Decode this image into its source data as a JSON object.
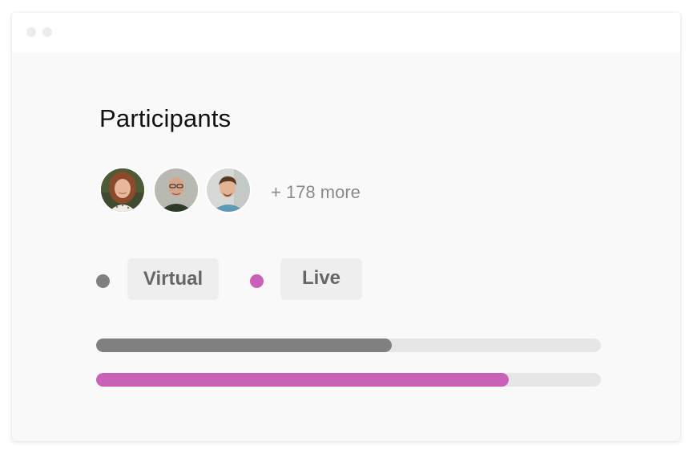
{
  "title": "Participants",
  "participants": {
    "more_label": "+ 178 more",
    "avatars": [
      {
        "icon": "avatar-woman-photo"
      },
      {
        "icon": "avatar-bald-man-glasses-photo"
      },
      {
        "icon": "avatar-young-man-photo"
      }
    ]
  },
  "legend": {
    "virtual": {
      "label": "Virtual",
      "color": "#808080"
    },
    "live": {
      "label": "Live",
      "color": "#c961b8"
    }
  },
  "progress": [
    {
      "series": "virtual",
      "fraction": 0.585,
      "color": "#808080",
      "track_color": "#e6e6e6"
    },
    {
      "series": "live",
      "fraction": 0.817,
      "color": "#c961b8",
      "track_color": "#e6e6e6"
    }
  ]
}
